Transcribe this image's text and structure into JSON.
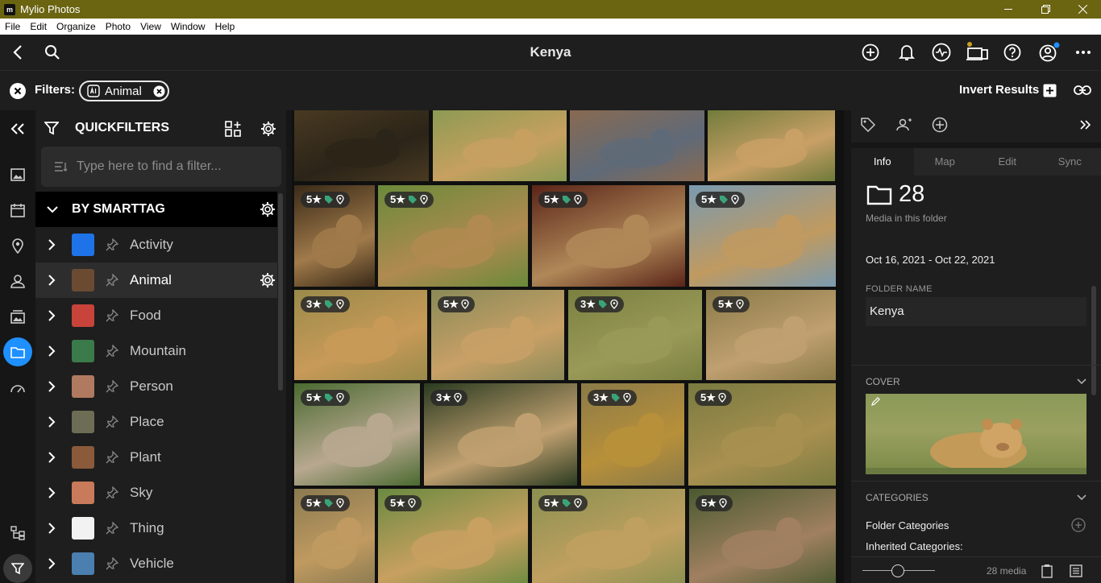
{
  "app": {
    "title": "Mylio Photos",
    "icon_text": "m"
  },
  "menu": [
    "File",
    "Edit",
    "Organize",
    "Photo",
    "View",
    "Window",
    "Help"
  ],
  "header": {
    "title": "Kenya"
  },
  "filters": {
    "label": "Filters:",
    "chip": "Animal",
    "invert": "Invert Results"
  },
  "quickfilters": {
    "title": "QUICKFILTERS",
    "search_placeholder": "Type here to find a filter...",
    "section": "BY SMARTTAG",
    "tags": [
      {
        "label": "Activity",
        "color": "#1e73e8"
      },
      {
        "label": "Animal",
        "color": "#6b4a32"
      },
      {
        "label": "Food",
        "color": "#c8433a"
      },
      {
        "label": "Mountain",
        "color": "#3b7a4a"
      },
      {
        "label": "Person",
        "color": "#b07a60"
      },
      {
        "label": "Place",
        "color": "#6d6d55"
      },
      {
        "label": "Plant",
        "color": "#8a5a3a"
      },
      {
        "label": "Sky",
        "color": "#c87a5a"
      },
      {
        "label": "Thing",
        "color": "#f2f2f2"
      },
      {
        "label": "Vehicle",
        "color": "#4a7fb0"
      }
    ]
  },
  "photos": [
    {
      "r": "",
      "c1": "#4a3a22",
      "c2": "#2b2418"
    },
    {
      "r": "",
      "c1": "#8a9a52",
      "c2": "#c7a060"
    },
    {
      "r": "",
      "c1": "#8a6a50",
      "c2": "#5f6a78"
    },
    {
      "r": "",
      "c1": "#6e7a3a",
      "c2": "#c9a066"
    },
    {
      "r": "5★",
      "c1": "#3a2a18",
      "c2": "#a07a4a"
    },
    {
      "r": "5★",
      "c1": "#6a8a3a",
      "c2": "#b08a50"
    },
    {
      "r": "5★",
      "c1": "#5a2418",
      "c2": "#b08858"
    },
    {
      "r": "5★",
      "c1": "#7a9ab0",
      "c2": "#c09a60"
    },
    {
      "r": "3★",
      "c1": "#9a8a4a",
      "c2": "#c89a58"
    },
    {
      "r": "5★",
      "c1": "#8a8a58",
      "c2": "#c8a066"
    },
    {
      "r": "3★",
      "c1": "#7a8040",
      "c2": "#9a9a58"
    },
    {
      "r": "5★",
      "c1": "#8a7a48",
      "c2": "#c0a070"
    },
    {
      "r": "5★",
      "c1": "#4a6a30",
      "c2": "#b8a890"
    },
    {
      "r": "3★",
      "c1": "#2a3a20",
      "c2": "#c0a070"
    },
    {
      "r": "3★",
      "c1": "#8a7a48",
      "c2": "#b8903a"
    },
    {
      "r": "5★",
      "c1": "#7a7a40",
      "c2": "#a89050"
    },
    {
      "r": "5★",
      "c1": "#8a7a50",
      "c2": "#c09a60"
    },
    {
      "r": "5★",
      "c1": "#6a8a40",
      "c2": "#c8a060"
    },
    {
      "r": "5★",
      "c1": "#8a9050",
      "c2": "#c0a060"
    },
    {
      "r": "5★",
      "c1": "#4a5a30",
      "c2": "#a08060"
    }
  ],
  "info": {
    "tabs": [
      "Info",
      "Map",
      "Edit",
      "Sync"
    ],
    "count": "28",
    "count_label": "Media in this folder",
    "dates": "Oct 16, 2021 - Oct 22, 2021",
    "folder_name_label": "FOLDER NAME",
    "folder_name": "Kenya",
    "cover_label": "COVER",
    "categories_label": "CATEGORIES",
    "folder_categories": "Folder Categories",
    "inherited_categories": "Inherited Categories:"
  },
  "footer": {
    "media_count": "28 media"
  },
  "colors": {
    "accent": "#1e90ff",
    "tag_icon": "#3aa37a"
  }
}
